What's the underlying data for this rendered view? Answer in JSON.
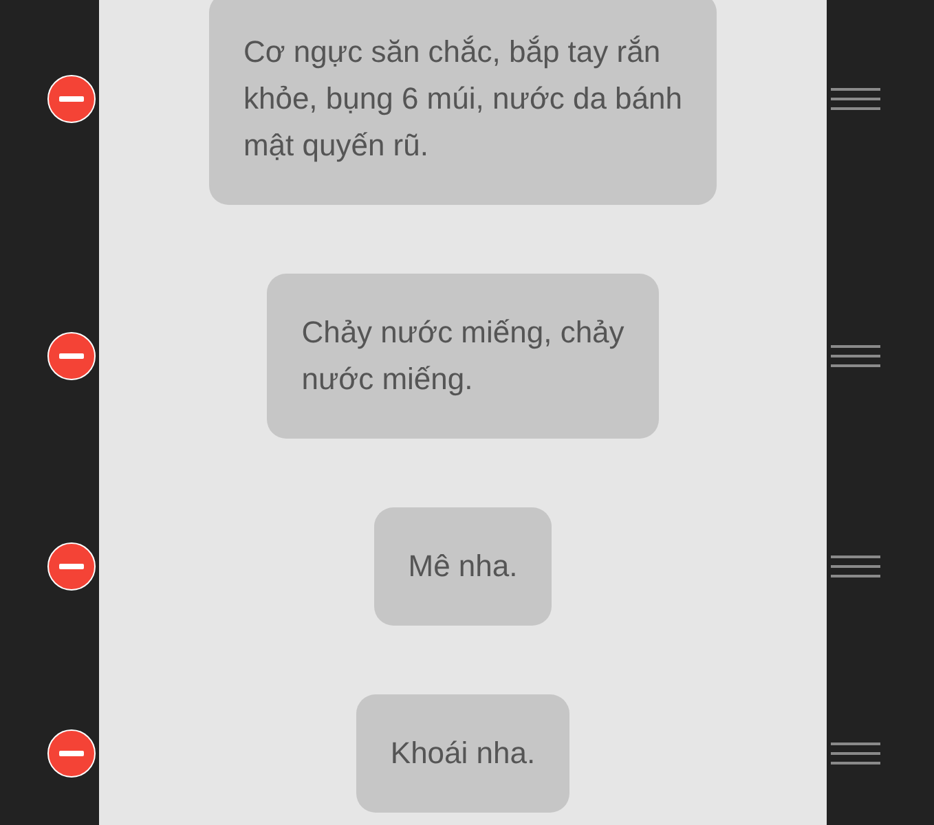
{
  "messages": [
    {
      "text": "Cơ ngực săn chắc, bắp tay rắn\nkhỏe, bụng 6 múi, nước da bánh\nmật quyến rũ."
    },
    {
      "text": "Chảy nước miếng, chảy\nnước miếng."
    },
    {
      "text": "Mê nha."
    },
    {
      "text": "Khoái nha."
    }
  ]
}
